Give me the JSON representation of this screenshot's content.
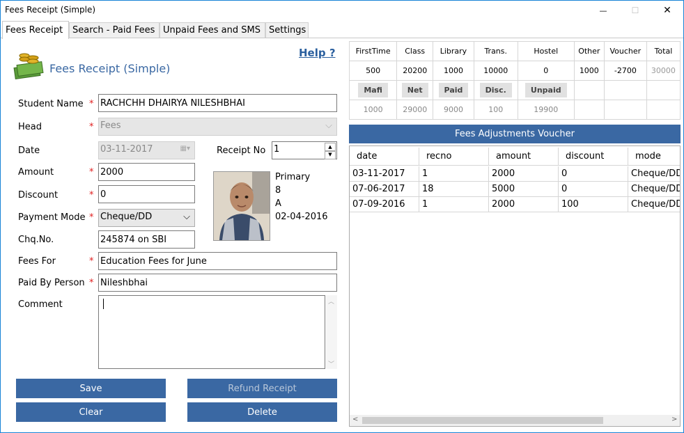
{
  "window": {
    "title": "Fees Receipt (Simple)",
    "minimize": "—",
    "maximize": "☐",
    "close": "✕"
  },
  "tabs": [
    "Fees Receipt",
    "Search - Paid Fees",
    "Unpaid Fees and SMS",
    "Settings"
  ],
  "header": {
    "title": "Fees Receipt (Simple)",
    "help": "Help ?"
  },
  "form": {
    "student_name_label": "Student Name",
    "student_name": "RACHCHH DHAIRYA NILESHBHAI",
    "head_label": "Head",
    "head": "Fees",
    "date_label": "Date",
    "date": "03-11-2017",
    "receipt_no_label": "Receipt No",
    "receipt_no": "1",
    "amount_label": "Amount",
    "amount": "2000",
    "discount_label": "Discount",
    "discount": "0",
    "payment_mode_label": "Payment Mode",
    "payment_mode": "Cheque/DD",
    "chq_label": "Chq.No.",
    "chq": "245874 on SBI",
    "fees_for_label": "Fees For",
    "fees_for": "Education Fees for June",
    "paid_by_label": "Paid By Person",
    "paid_by": "Nileshbhai",
    "comment_label": "Comment",
    "comment": "",
    "required_mark": "*"
  },
  "student_info": {
    "section": "Primary",
    "std": "8",
    "division": "A",
    "dob": "02-04-2016"
  },
  "buttons": {
    "save": "Save",
    "refund": "Refund Receipt",
    "clear": "Clear",
    "delete": "Delete"
  },
  "fee_grid": {
    "headers": [
      "FirstTime",
      "Class",
      "Library",
      "Trans.",
      "Hostel",
      "Other",
      "Voucher",
      "Total"
    ],
    "values": [
      "500",
      "20200",
      "1000",
      "10000",
      "0",
      "1000",
      "-2700",
      "30000"
    ],
    "summary_buttons": [
      "Mafi",
      "Net",
      "Paid",
      "Disc.",
      "Unpaid"
    ],
    "summary_values": [
      "1000",
      "29000",
      "9000",
      "100",
      "19900"
    ]
  },
  "voucher_bar": "Fees Adjustments Voucher",
  "history": {
    "columns": [
      "date",
      "recno",
      "amount",
      "discount",
      "mode"
    ],
    "rows": [
      {
        "date": "03-11-2017",
        "recno": "1",
        "amount": "2000",
        "discount": "0",
        "mode": "Cheque/DD"
      },
      {
        "date": "07-06-2017",
        "recno": "18",
        "amount": "5000",
        "discount": "0",
        "mode": "Cheque/DD"
      },
      {
        "date": "07-09-2016",
        "recno": "1",
        "amount": "2000",
        "discount": "100",
        "mode": "Cheque/DD"
      }
    ]
  },
  "colors": {
    "accent": "#3a68a3",
    "required": "#e02020",
    "help": "#2a5f9e"
  }
}
